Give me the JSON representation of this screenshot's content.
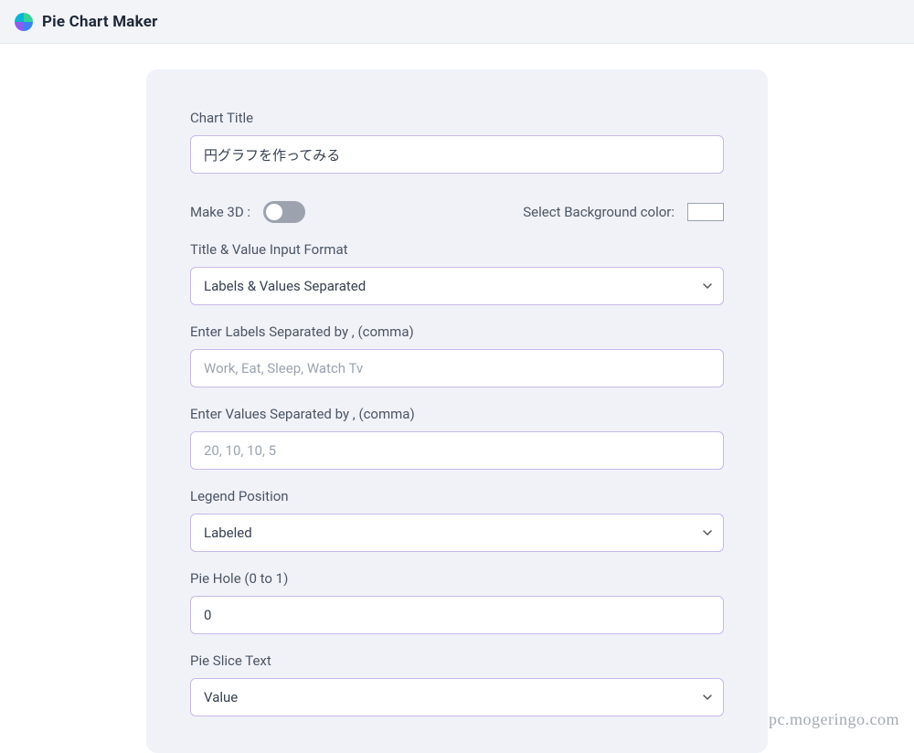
{
  "header": {
    "app_title": "Pie Chart Maker"
  },
  "form": {
    "chart_title": {
      "label": "Chart Title",
      "value": "円グラフを作ってみる"
    },
    "make_3d": {
      "label": "Make 3D :",
      "on": false
    },
    "bg_color": {
      "label": "Select Background color:",
      "value": "#ffffff"
    },
    "input_format": {
      "label": "Title & Value Input Format",
      "value": "Labels & Values Separated"
    },
    "labels": {
      "label": "Enter Labels Separated by , (comma)",
      "placeholder": "Work, Eat, Sleep, Watch Tv",
      "value": ""
    },
    "values": {
      "label": "Enter Values Separated by , (comma)",
      "placeholder": "20, 10, 10, 5",
      "value": ""
    },
    "legend_position": {
      "label": "Legend Position",
      "value": "Labeled"
    },
    "pie_hole": {
      "label": "Pie Hole (0 to 1)",
      "value": "0"
    },
    "pie_slice_text": {
      "label": "Pie Slice Text",
      "value": "Value"
    }
  },
  "watermark": "pc.mogeringo.com"
}
